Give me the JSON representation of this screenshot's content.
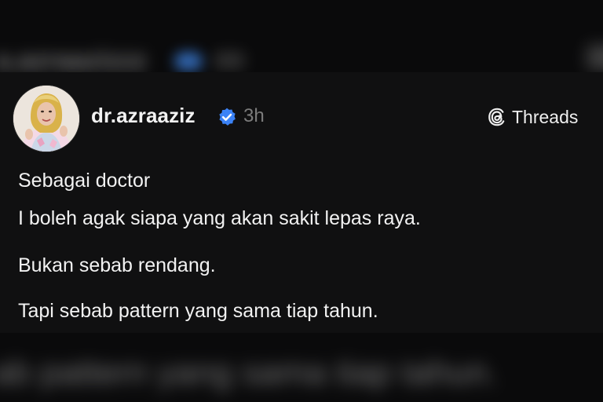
{
  "post": {
    "username": "dr.azraaziz",
    "timestamp": "3h",
    "verified": true,
    "platform_label": "Threads",
    "lines": [
      "Sebagai doctor",
      "I boleh agak siapa yang akan sakit lepas raya.",
      "Bukan sebab rendang.",
      "Tapi sebab pattern yang sama tiap tahun."
    ]
  },
  "icons": {
    "avatar": "profile-photo",
    "verified": "verified-badge-icon",
    "platform": "threads-logo-icon"
  },
  "colors": {
    "background": "#101011",
    "text": "#f2f2f2",
    "muted": "#7c7c7c",
    "verified": "#3b82f6"
  }
}
